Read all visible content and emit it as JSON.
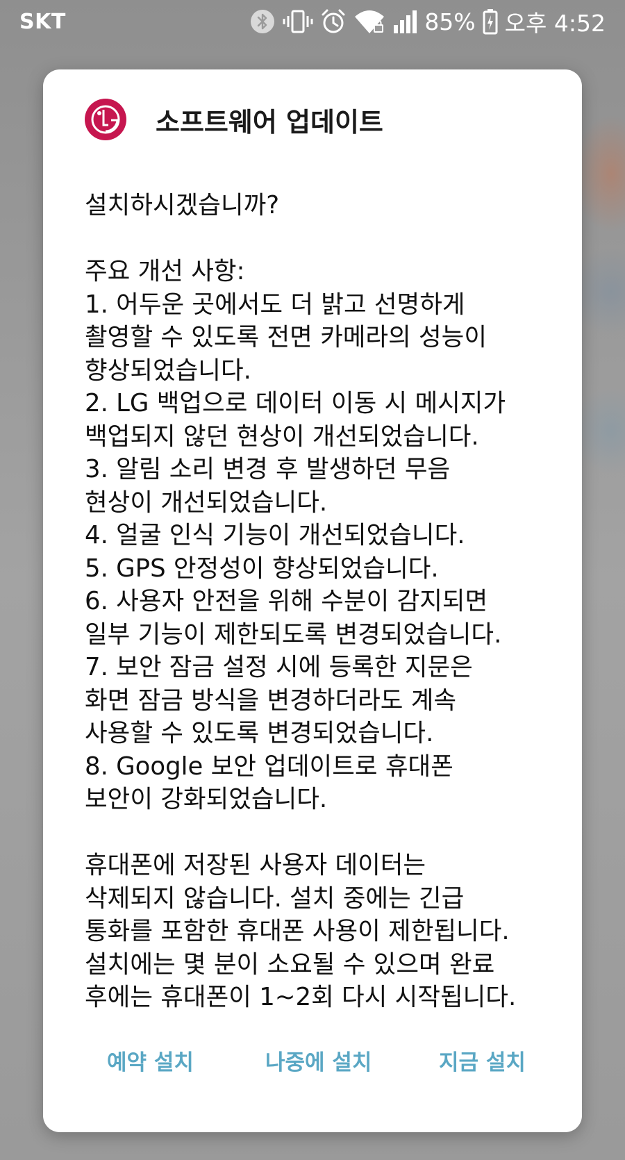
{
  "status_bar": {
    "carrier": "SKT",
    "battery_percent": "85%",
    "time": "오후 4:52",
    "icons": [
      "bluetooth-icon",
      "vibrate-icon",
      "alarm-icon",
      "wifi-icon",
      "signal-icon",
      "battery-icon"
    ]
  },
  "dialog": {
    "logo": "lg-logo",
    "title": "소프트웨어 업데이트",
    "body": "설치하시겠습니까?\n\n주요 개선 사항:\n1. 어두운 곳에서도 더 밝고 선명하게\n촬영할 수 있도록 전면 카메라의 성능이\n향상되었습니다.\n2. LG 백업으로 데이터 이동 시 메시지가\n백업되지 않던 현상이 개선되었습니다.\n3. 알림 소리 변경 후 발생하던 무음\n현상이 개선되었습니다.\n4. 얼굴 인식 기능이 개선되었습니다.\n5. GPS 안정성이 향상되었습니다.\n6. 사용자 안전을 위해 수분이 감지되면\n일부 기능이 제한되도록 변경되었습니다.\n7. 보안 잠금 설정 시에 등록한 지문은\n화면 잠금 방식을 변경하더라도 계속\n사용할 수 있도록 변경되었습니다.\n8. Google 보안 업데이트로 휴대폰\n보안이 강화되었습니다.\n\n휴대폰에 저장된 사용자 데이터는\n삭제되지 않습니다. 설치 중에는 긴급\n통화를 포함한 휴대폰 사용이 제한됩니다.\n설치에는 몇 분이 소요될 수 있으며 완료\n후에는 휴대폰이 1~2회 다시 시작됩니다.",
    "buttons": {
      "schedule": "예약 설치",
      "later": "나중에 설치",
      "now": "지금 설치"
    }
  },
  "colors": {
    "accent": "#5aa7c4",
    "lg_brand": "#c6164f"
  }
}
